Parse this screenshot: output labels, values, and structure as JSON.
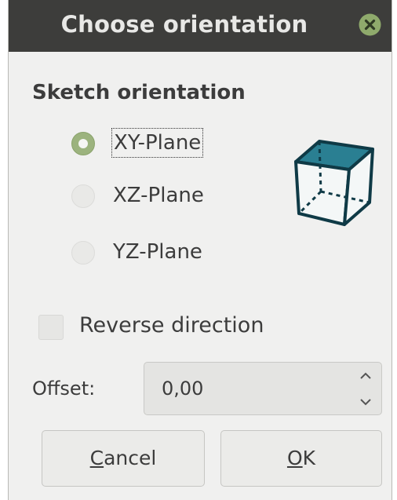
{
  "window": {
    "title": "Choose orientation",
    "close_icon": "close-circle-icon"
  },
  "orientation": {
    "group_title": "Sketch orientation",
    "options": [
      {
        "label": "XY-Plane",
        "checked": true
      },
      {
        "label": "XZ-Plane",
        "checked": false
      },
      {
        "label": "YZ-Plane",
        "checked": false
      }
    ],
    "preview_icon": "cube-icon"
  },
  "reverse": {
    "label": "Reverse direction",
    "checked": false
  },
  "offset": {
    "label": "Offset:",
    "value": "0,00"
  },
  "buttons": {
    "cancel": {
      "mnemonic": "C",
      "rest": "ancel"
    },
    "ok": {
      "mnemonic": "O",
      "rest": "K"
    }
  },
  "colors": {
    "titlebar": "#3d3d3b",
    "accent_green": "#9cb37e",
    "cube_top": "#2a7f92",
    "cube_outline": "#0f3a46"
  }
}
